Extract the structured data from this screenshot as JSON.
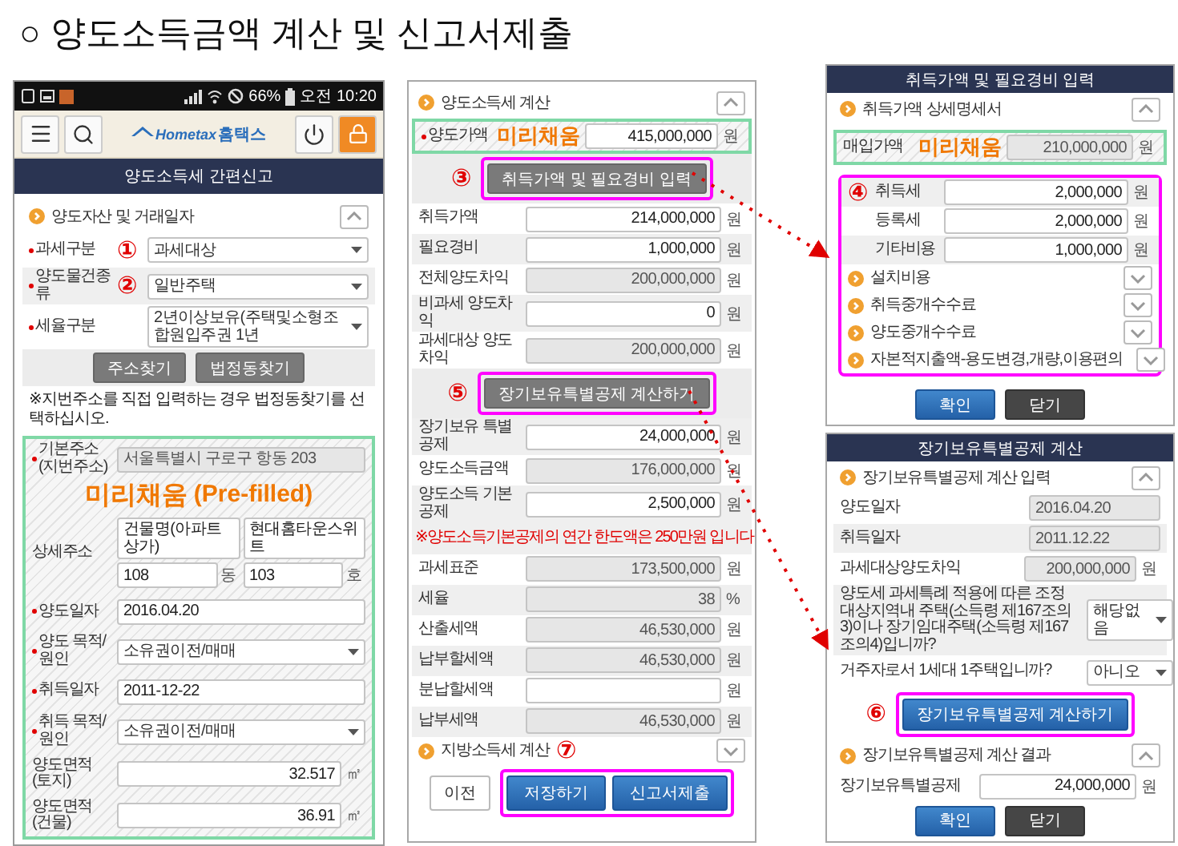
{
  "title": "○ 양도소득금액 계산 및 신고서제출",
  "phone": {
    "status_bar": {
      "battery": "66%",
      "time": "오전 10:20"
    },
    "logo": {
      "latin": "Hometax",
      "hangul": "홈택스"
    },
    "header": "양도소득세 간편신고",
    "section": {
      "title": "양도자산 및 거래일자",
      "expanded": true
    },
    "fields": [
      {
        "label": "과세구분",
        "marker": "①",
        "value": "과세대상",
        "required": true
      },
      {
        "label": "양도물건종류",
        "marker": "②",
        "value": "일반주택",
        "required": true
      },
      {
        "label": "세율구분",
        "value": "2년이상보유(주택및소형조합원입주권 1년",
        "required": true
      }
    ],
    "buttons": [
      "주소찾기",
      "법정동찾기"
    ],
    "note": "※지번주소를 직접 입력하는 경우 법정동찾기를 선택하십시오.",
    "prefilled": {
      "badge": "미리채움",
      "badge_en": "(Pre-filled)",
      "rows": [
        {
          "kind": "input",
          "label": "기본주소 (지번주소)",
          "value": "서울특별시 구로구 항동 203",
          "required": true,
          "readonly": true
        },
        {
          "kind": "address",
          "label": "상세주소",
          "building": "건물명(아파트 상가)",
          "building_name": "현대홈타운스위트",
          "dong": "108",
          "dong_unit": "동",
          "ho": "103",
          "ho_unit": "호",
          "required": false
        },
        {
          "kind": "input",
          "label": "양도일자",
          "value": "2016.04.20",
          "required": true,
          "readonly": false
        },
        {
          "kind": "select",
          "label": "양도 목적/원인",
          "value": "소유권이전/매매",
          "required": true
        },
        {
          "kind": "input",
          "label": "취득일자",
          "value": "2011-12-22",
          "required": true,
          "readonly": false
        },
        {
          "kind": "select",
          "label": "취득 목적/원인",
          "value": "소유권이전/매매",
          "required": true
        },
        {
          "kind": "number",
          "label": "양도면적 (토지)",
          "value": "32.517",
          "unit": "㎡",
          "required": false
        },
        {
          "kind": "number",
          "label": "양도면적 (건물)",
          "value": "36.91",
          "unit": "㎡",
          "required": false
        }
      ]
    }
  },
  "tax_calc": {
    "section": {
      "title": "양도소득세 계산",
      "expanded": true
    },
    "rows": [
      {
        "kind": "input",
        "label": "양도가액",
        "badge": "미리채움",
        "value": "415,000,000",
        "unit": "원",
        "required": true,
        "readonly": false
      },
      {
        "kind": "button",
        "marker": "③",
        "label": "취득가액 및 필요경비 입력",
        "highlighted": true
      },
      {
        "kind": "input",
        "label": "취득가액",
        "value": "214,000,000",
        "unit": "원",
        "readonly": false
      },
      {
        "kind": "input",
        "label": "필요경비",
        "value": "1,000,000",
        "unit": "원",
        "readonly": false
      },
      {
        "kind": "input",
        "label": "전체양도차익",
        "value": "200,000,000",
        "unit": "원",
        "readonly": true
      },
      {
        "kind": "input",
        "label": "비과세 양도차익",
        "value": "0",
        "unit": "원",
        "readonly": false
      },
      {
        "kind": "input",
        "label": "과세대상 양도차익",
        "value": "200,000,000",
        "unit": "원",
        "readonly": true
      },
      {
        "kind": "button",
        "marker": "⑤",
        "label": "장기보유특별공제 계산하기",
        "highlighted": true
      },
      {
        "kind": "input",
        "label": "장기보유 특별공제",
        "value": "24,000,000",
        "unit": "원",
        "readonly": false
      },
      {
        "kind": "input",
        "label": "양도소득금액",
        "value": "176,000,000",
        "unit": "원",
        "readonly": true
      },
      {
        "kind": "input",
        "label": "양도소득 기본공제",
        "value": "2,500,000",
        "unit": "원",
        "readonly": false
      },
      {
        "kind": "note",
        "text": "※양도소득기본공제의 연간 한도액은 250만원 입니다"
      },
      {
        "kind": "input",
        "label": "과세표준",
        "value": "173,500,000",
        "unit": "원",
        "readonly": true
      },
      {
        "kind": "input",
        "label": "세율",
        "value": "38",
        "unit": "%",
        "readonly": true
      },
      {
        "kind": "input",
        "label": "산출세액",
        "value": "46,530,000",
        "unit": "원",
        "readonly": true
      },
      {
        "kind": "input",
        "label": "납부할세액",
        "value": "46,530,000",
        "unit": "원",
        "readonly": true
      },
      {
        "kind": "input",
        "label": "분납할세액",
        "unit": "원",
        "readonly": false
      },
      {
        "kind": "input",
        "label": "납부세액",
        "value": "46,530,000",
        "unit": "원",
        "readonly": true
      }
    ],
    "local_section": {
      "title": "지방소득세 계산",
      "marker": "⑦",
      "expanded": false
    },
    "actions": [
      {
        "label": "이전",
        "kind": "plain",
        "highlighted": false
      },
      {
        "label": "저장하기",
        "kind": "primary",
        "highlighted": true
      },
      {
        "label": "신고서제출",
        "kind": "primary",
        "highlighted": true
      }
    ]
  },
  "acquisition_popup": {
    "header": "취득가액 및 필요경비 입력",
    "section": {
      "title": "취득가액 상세명세서",
      "expanded": true
    },
    "prefilled_row": {
      "label": "매입가액",
      "badge": "미리채움",
      "value": "210,000,000",
      "unit": "원",
      "readonly": true
    },
    "highlight": {
      "marker": "④",
      "highlighted": true,
      "rows": [
        {
          "kind": "input",
          "label": "취득세",
          "value": "2,000,000",
          "unit": "원"
        },
        {
          "kind": "input",
          "label": "등록세",
          "value": "2,000,000",
          "unit": "원"
        },
        {
          "kind": "input",
          "label": "기타비용",
          "value": "1,000,000",
          "unit": "원"
        },
        {
          "kind": "section",
          "title": "설치비용",
          "expanded": false
        },
        {
          "kind": "section",
          "title": "취득중개수수료",
          "expanded": false
        },
        {
          "kind": "section",
          "title": "양도중개수수료",
          "expanded": false
        },
        {
          "kind": "section",
          "title": "자본적지출액-용도변경,개량,이용편의",
          "expanded": false
        }
      ]
    },
    "buttons": [
      {
        "label": "확인",
        "kind": "primary"
      },
      {
        "label": "닫기",
        "kind": "dark"
      }
    ]
  },
  "deduction_popup": {
    "header": "장기보유특별공제 계산",
    "section": {
      "title": "장기보유특별공제 계산 입력",
      "expanded": true
    },
    "rows": [
      {
        "kind": "input",
        "label": "양도일자",
        "value": "2016.04.20",
        "readonly": true
      },
      {
        "kind": "input",
        "label": "취득일자",
        "value": "2011.12.22",
        "readonly": true
      },
      {
        "kind": "input",
        "label": "과세대상양도차익",
        "value": "200,000,000",
        "unit": "원",
        "readonly": true
      },
      {
        "kind": "select",
        "label": "양도세 과세특례 적용에 따른 조정대상지역내 주택(소득령 제167조의3)이나 장기임대주택(소득령 제167조의4)입니까?",
        "value": "해당없음"
      },
      {
        "kind": "select",
        "label": "거주자로서 1세대 1주택입니까?",
        "value": "아니오"
      }
    ],
    "action": {
      "marker": "⑥",
      "label": "장기보유특별공제 계산하기",
      "highlighted": true
    },
    "result_section": {
      "title": "장기보유특별공제 계산 결과",
      "expanded": true
    },
    "result_row": {
      "label": "장기보유특별공제",
      "value": "24,000,000",
      "unit": "원",
      "readonly": false
    },
    "buttons": [
      {
        "label": "확인",
        "kind": "primary"
      },
      {
        "label": "닫기",
        "kind": "dark"
      }
    ]
  }
}
